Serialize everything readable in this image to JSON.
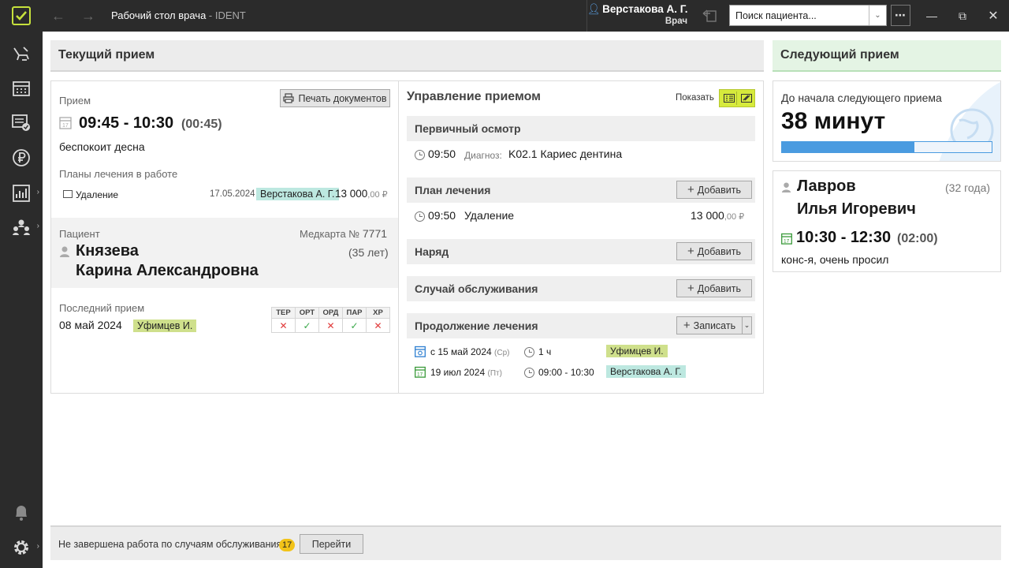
{
  "titlebar": {
    "app_title": "Рабочий стол врача",
    "app_suffix": " - IDENT",
    "user_name": "Верстакова А. Г.",
    "user_role": "Врач",
    "search_placeholder": "Поиск пациента..."
  },
  "sidebar": {
    "items": [
      {
        "icon": "dental-chair-icon"
      },
      {
        "icon": "calendar-schedule-icon"
      },
      {
        "icon": "task-list-icon"
      },
      {
        "icon": "ruble-icon"
      },
      {
        "icon": "chart-icon"
      },
      {
        "icon": "people-icon"
      },
      {
        "icon": "bell-icon"
      },
      {
        "icon": "gear-icon"
      }
    ]
  },
  "current": {
    "header": "Текущий прием",
    "appointment_label": "Прием",
    "print_button": "Печать документов",
    "time_range": "09:45 - 10:30",
    "duration": "(00:45)",
    "complaint": "беспокоит десна",
    "plans_label": "Планы лечения в работе",
    "plan": {
      "name": "Удаление",
      "date": "17.05.2024",
      "doctor": "Верстакова А. Г.",
      "amount": "13 000",
      "kopecks": ",00 ₽"
    },
    "patient_label": "Пациент",
    "medcard_label": "Медкарта №",
    "medcard_no": "7771",
    "patient_last": "Князева",
    "patient_first": "Карина Александровна",
    "patient_age": "(35 лет)",
    "last_visit_label": "Последний прием",
    "last_visit_date": "08 май 2024",
    "last_visit_doctor": "Уфимцев И.",
    "hygiene": {
      "headers": [
        "ТЕР",
        "ОРТ",
        "ОРД",
        "ПАР",
        "ХР"
      ],
      "values": [
        "✕",
        "✓",
        "✕",
        "✓",
        "✕"
      ]
    }
  },
  "management": {
    "title": "Управление приемом",
    "show_label": "Показать",
    "primary_exam": "Первичный осмотр",
    "exam_time": "09:50",
    "diagnosis_label": "Диагноз:",
    "diagnosis": "K02.1 Кариес дентина",
    "treatment_plan": "План лечения",
    "add_label": "Добавить",
    "plan_time": "09:50",
    "plan_item": "Удаление",
    "plan_amount": "13 000",
    "plan_kopecks": ",00 ₽",
    "order": "Наряд",
    "service_case": "Случай обслуживания",
    "continue": "Продолжение лечения",
    "record_label": "Записать",
    "followups": [
      {
        "date": "с 15 май 2024",
        "weekday": "(Ср)",
        "time": "1 ч",
        "doctor": "Уфимцев И."
      },
      {
        "date": "19 июл 2024",
        "weekday": "(Пт)",
        "time": "09:00 - 10:30",
        "doctor": "Верстакова А. Г."
      }
    ]
  },
  "next": {
    "header": "Следующий прием",
    "countdown_label": "До начала следующего приема",
    "countdown": "38 минут",
    "progress_fraction": 0.63,
    "patient_last": "Лавров",
    "patient_first": "Илья Игоревич",
    "patient_age": "(32 года)",
    "time_range": "10:30 - 12:30",
    "duration": "(02:00)",
    "note": "конс-я, очень просил"
  },
  "footer": {
    "message": "Не завершена работа по случаям обслуживания",
    "count": "17",
    "go_button": "Перейти"
  },
  "colors": {
    "accent_green": "#c6e13c",
    "progress_blue": "#4a9be0",
    "tag_cyan": "#bde8e0",
    "tag_olive": "#cfe08c",
    "badge_yellow": "#f2c318"
  }
}
